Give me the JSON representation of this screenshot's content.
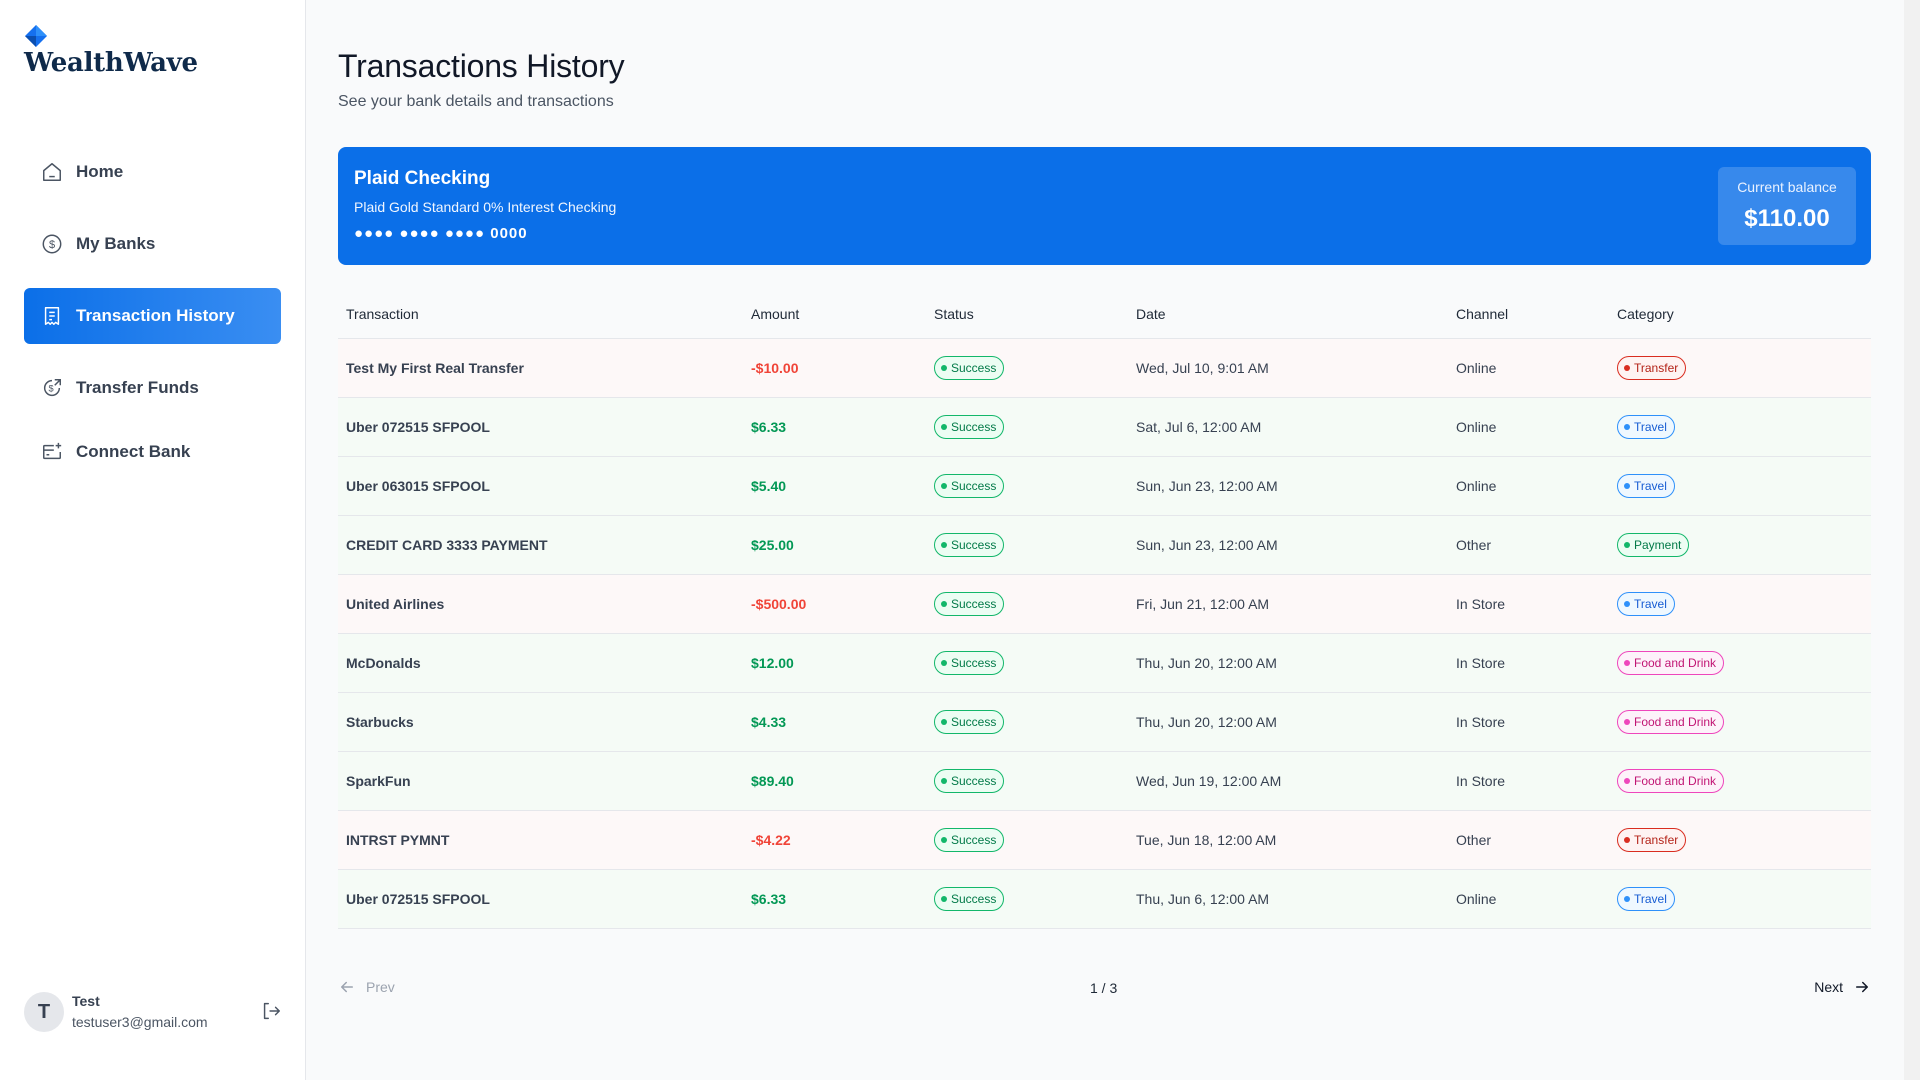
{
  "brand": {
    "name": "WealthWave",
    "icon": "diamond-logo-icon",
    "accent": "#0b6fe8"
  },
  "sidebar": {
    "items": [
      {
        "label": "Home",
        "icon": "home-icon",
        "active": false
      },
      {
        "label": "My Banks",
        "icon": "dollar-circle-icon",
        "active": false
      },
      {
        "label": "Transaction History",
        "icon": "receipt-icon",
        "active": true
      },
      {
        "label": "Transfer Funds",
        "icon": "money-send-icon",
        "active": false
      },
      {
        "label": "Connect Bank",
        "icon": "card-add-icon",
        "active": false
      }
    ]
  },
  "user": {
    "initial": "T",
    "name": "Test",
    "email": "testuser3@gmail.com"
  },
  "header": {
    "title": "Transactions History",
    "subtitle": "See your bank details and transactions"
  },
  "bank": {
    "name": "Plaid Checking",
    "official_name": "Plaid Gold Standard 0% Interest Checking",
    "mask": "●●●● ●●●● ●●●● 0000",
    "balance_label": "Current balance",
    "balance": "$110.00"
  },
  "table": {
    "columns": [
      "Transaction",
      "Amount",
      "Status",
      "Date",
      "Channel",
      "Category"
    ],
    "rows": [
      {
        "name": "Test My First Real Transfer",
        "amount": "-$10.00",
        "status": "Success",
        "date": "Wed, Jul 10, 9:01 AM",
        "channel": "Online",
        "category": "Transfer"
      },
      {
        "name": "Uber 072515 SFPOOL",
        "amount": "$6.33",
        "status": "Success",
        "date": "Sat, Jul 6, 12:00 AM",
        "channel": "Online",
        "category": "Travel"
      },
      {
        "name": "Uber 063015 SFPOOL",
        "amount": "$5.40",
        "status": "Success",
        "date": "Sun, Jun 23, 12:00 AM",
        "channel": "Online",
        "category": "Travel"
      },
      {
        "name": "CREDIT CARD 3333 PAYMENT",
        "amount": "$25.00",
        "status": "Success",
        "date": "Sun, Jun 23, 12:00 AM",
        "channel": "Other",
        "category": "Payment"
      },
      {
        "name": "United Airlines",
        "amount": "-$500.00",
        "status": "Success",
        "date": "Fri, Jun 21, 12:00 AM",
        "channel": "In Store",
        "category": "Travel"
      },
      {
        "name": "McDonalds",
        "amount": "$12.00",
        "status": "Success",
        "date": "Thu, Jun 20, 12:00 AM",
        "channel": "In Store",
        "category": "Food and Drink"
      },
      {
        "name": "Starbucks",
        "amount": "$4.33",
        "status": "Success",
        "date": "Thu, Jun 20, 12:00 AM",
        "channel": "In Store",
        "category": "Food and Drink"
      },
      {
        "name": "SparkFun",
        "amount": "$89.40",
        "status": "Success",
        "date": "Wed, Jun 19, 12:00 AM",
        "channel": "In Store",
        "category": "Food and Drink"
      },
      {
        "name": "INTRST PYMNT",
        "amount": "-$4.22",
        "status": "Success",
        "date": "Tue, Jun 18, 12:00 AM",
        "channel": "Other",
        "category": "Transfer"
      },
      {
        "name": "Uber 072515 SFPOOL",
        "amount": "$6.33",
        "status": "Success",
        "date": "Thu, Jun 6, 12:00 AM",
        "channel": "Online",
        "category": "Travel"
      }
    ]
  },
  "pagination": {
    "prev": "Prev",
    "next": "Next",
    "page": "1 / 3"
  },
  "colors": {
    "debit": "#f04438",
    "credit": "#039855",
    "transfer": "#d92d20",
    "travel": "#2e90fa",
    "payment": "#12b76a",
    "food": "#ee46bc"
  }
}
